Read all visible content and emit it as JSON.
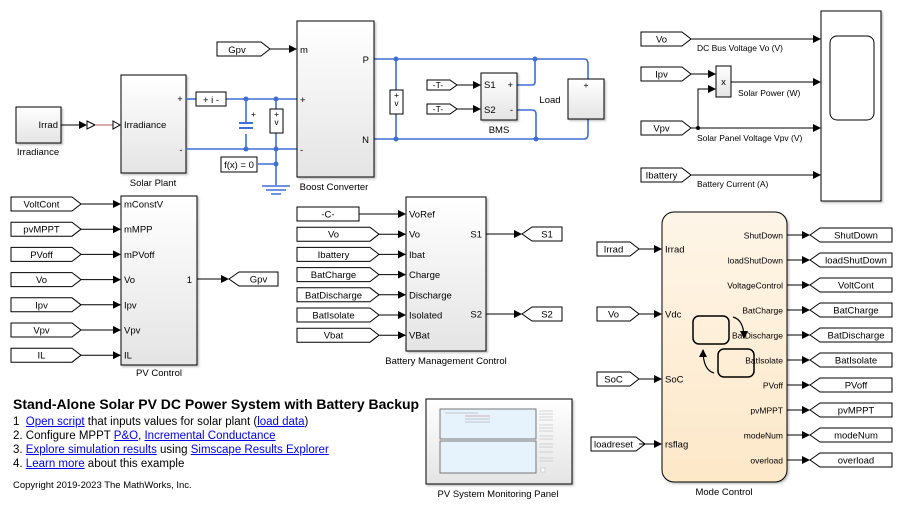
{
  "diagram": {
    "title": "Stand-Alone Solar PV DC Power System with Battery Backup",
    "steps": [
      {
        "prefix": "1  ",
        "parts": [
          {
            "text": "Open script",
            "link": true
          },
          {
            "text": " that inputs values for solar plant (",
            "link": false
          },
          {
            "text": "load data",
            "link": true
          },
          {
            "text": ")",
            "link": false
          }
        ]
      },
      {
        "prefix": "2. ",
        "parts": [
          {
            "text": "Configure MPPT ",
            "link": false
          },
          {
            "text": "P&O",
            "link": true
          },
          {
            "text": ", ",
            "link": false
          },
          {
            "text": "Incremental Conductance",
            "link": true
          }
        ]
      },
      {
        "prefix": "3. ",
        "parts": [
          {
            "text": "Explore simulation results",
            "link": true
          },
          {
            "text": " using ",
            "link": false
          },
          {
            "text": "Simscape Results Explorer",
            "link": true
          }
        ]
      },
      {
        "prefix": "4. ",
        "parts": [
          {
            "text": "Learn more",
            "link": true
          },
          {
            "text": " about this example",
            "link": false
          }
        ]
      }
    ],
    "copyright": "Copyright 2019-2023 The MathWorks, Inc."
  },
  "blocks": {
    "irradiance": {
      "name": "Irradiance",
      "port": "Irrad"
    },
    "solar_plant": {
      "name": "Solar Plant",
      "in_port": "Irradiance",
      "plus": "+",
      "minus": "-"
    },
    "current_sensor": {
      "label": "+  i  -"
    },
    "voltage_sensor": {
      "plus": "+",
      "v": "v",
      "minus": "-"
    },
    "capacitor": {
      "plus": "+"
    },
    "solver": {
      "label": "f(x) = 0"
    },
    "boost": {
      "name": "Boost Converter",
      "ports_in": [
        "m",
        "+",
        "-"
      ],
      "ports_out": [
        "P",
        "N"
      ]
    },
    "bms": {
      "name": "BMS",
      "ports_in": [
        "S1",
        "S2"
      ],
      "ports_out": [
        "+",
        "-"
      ]
    },
    "load": {
      "name": "Load",
      "plus": "+"
    },
    "gpv_from": {
      "label": "Gpv"
    },
    "t1": {
      "label": "-T-"
    },
    "t2": {
      "label": "-T-"
    },
    "scope_inputs": [
      {
        "tag": "Vo",
        "signal": "DC Bus Voltage Vo (V)"
      },
      {
        "tag": "Ipv",
        "signal": "Solar Power (W)"
      },
      {
        "tag": "Vpv",
        "signal": "Solar Panel Voltage Vpv (V)"
      },
      {
        "tag": "Ibattery",
        "signal": "Battery Current (A)"
      }
    ],
    "product": {
      "label": "x"
    },
    "pv_control": {
      "name": "PV Control",
      "inputs": [
        {
          "tag": "VoltCont",
          "port": "mConstV"
        },
        {
          "tag": "pvMPPT",
          "port": "mMPP"
        },
        {
          "tag": "PVoff",
          "port": "mPVoff"
        },
        {
          "tag": "Vo",
          "port": "Vo"
        },
        {
          "tag": "Ipv",
          "port": "Ipv"
        },
        {
          "tag": "Vpv",
          "port": "Vpv"
        },
        {
          "tag": "IL",
          "port": "IL"
        }
      ],
      "out_port": "1",
      "out_tag": "Gpv"
    },
    "bmc": {
      "name": "Battery Management Control",
      "inputs": [
        {
          "tag": "-C-",
          "port": "VoRef"
        },
        {
          "tag": "Vo",
          "port": "Vo"
        },
        {
          "tag": "Ibattery",
          "port": "Ibat"
        },
        {
          "tag": "BatCharge",
          "port": "Charge"
        },
        {
          "tag": "BatDischarge",
          "port": "Discharge"
        },
        {
          "tag": "BatIsolate",
          "port": "Isolated"
        },
        {
          "tag": "Vbat",
          "port": "VBat"
        }
      ],
      "outputs": [
        {
          "port": "S1",
          "tag": "S1"
        },
        {
          "port": "S2",
          "tag": "S2"
        }
      ]
    },
    "mode_control": {
      "name": "Mode Control",
      "inputs": [
        {
          "tag": "Irrad",
          "port": "Irrad"
        },
        {
          "tag": "Vo",
          "port": "Vdc"
        },
        {
          "tag": "SoC",
          "port": "SoC"
        },
        {
          "tag": "loadreset",
          "port": "rsflag"
        }
      ],
      "outputs": [
        {
          "port": "ShutDown",
          "tag": "ShutDown"
        },
        {
          "port": "loadShutDown",
          "tag": "loadShutDown"
        },
        {
          "port": "VoltageControl",
          "tag": "VoltCont"
        },
        {
          "port": "BatCharge",
          "tag": "BatCharge"
        },
        {
          "port": "BatDischarge",
          "tag": "BatDischarge"
        },
        {
          "port": "BatIsolate",
          "tag": "BatIsolate"
        },
        {
          "port": "PVoff",
          "tag": "PVoff"
        },
        {
          "port": "pvMPPT",
          "tag": "pvMPPT"
        },
        {
          "port": "modeNum",
          "tag": "modeNum"
        },
        {
          "port": "overload",
          "tag": "overload"
        }
      ]
    },
    "monitor": {
      "name": "PV System Monitoring Panel"
    }
  },
  "colors": {
    "physical_wire": "#3b6fd6",
    "stateflow_fill": "#fdf0dc"
  }
}
